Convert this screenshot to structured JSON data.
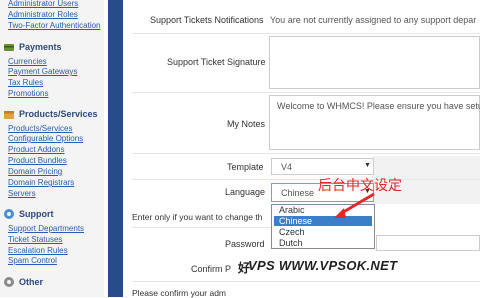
{
  "sidebar": {
    "top_links": [
      "Administrator Users",
      "Administrator Roles",
      "Two-Factor Authentication"
    ],
    "payments": {
      "heading": "Payments",
      "links": [
        "Currencies",
        "Payment Gateways",
        "Tax Rules",
        "Promotions"
      ]
    },
    "products": {
      "heading": "Products/Services",
      "links": [
        "Products/Services",
        "Configurable Options",
        "Product Addons",
        "Product Bundles",
        "Domain Pricing",
        "Domain Registrars",
        "Servers"
      ]
    },
    "support": {
      "heading": "Support",
      "links": [
        "Support Departments",
        "Ticket Statuses",
        "Escalation Rules",
        "Spam Control"
      ]
    },
    "other": {
      "heading": "Other"
    }
  },
  "form": {
    "support_notifications_label": "Support Tickets Notifications",
    "support_notifications_value": "You are not currently assigned to any support depar",
    "signature_label": "Support Ticket Signature",
    "my_notes_label": "My Notes",
    "my_notes_value": "Welcome to WHMCS!  Please ensure you have setu",
    "template_label": "Template",
    "template_value": "V4",
    "language_label": "Language",
    "language_value": "Chinese",
    "password_hint": "Enter only if you want to change th",
    "password_label": "Password",
    "confirm_label": "Confirm P",
    "bottom_hint": "Please confirm your adm"
  },
  "language_options": [
    {
      "label": "Arabic",
      "selected": false
    },
    {
      "label": "Chinese",
      "selected": true
    },
    {
      "label": "Czech",
      "selected": false
    },
    {
      "label": "Dutch",
      "selected": false
    }
  ],
  "annotation": {
    "text": "后台中文设定",
    "color": "#e62727"
  },
  "watermark": "VPS WWW.VPSOK.NET",
  "colors": {
    "stripe": "#264c8c",
    "link": "#2a5db0",
    "selection": "#3c7fc9"
  }
}
